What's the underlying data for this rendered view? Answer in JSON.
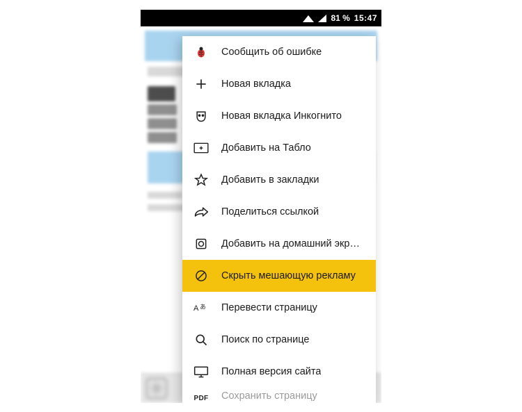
{
  "statusbar": {
    "battery": "81 %",
    "time": "15:47"
  },
  "menu": {
    "items": [
      {
        "label": "Сообщить об ошибке",
        "icon": "bug-icon",
        "highlight": false
      },
      {
        "label": "Новая вкладка",
        "icon": "plus-icon",
        "highlight": false
      },
      {
        "label": "Новая вкладка Инкогнито",
        "icon": "incognito-icon",
        "highlight": false
      },
      {
        "label": "Добавить на Табло",
        "icon": "dashboard-icon",
        "highlight": false
      },
      {
        "label": "Добавить в закладки",
        "icon": "star-icon",
        "highlight": false
      },
      {
        "label": "Поделиться ссылкой",
        "icon": "share-icon",
        "highlight": false
      },
      {
        "label": "Добавить на домашний экр…",
        "icon": "homescreen-icon",
        "highlight": false
      },
      {
        "label": "Скрыть мешающую рекламу",
        "icon": "block-icon",
        "highlight": true
      },
      {
        "label": "Перевести страницу",
        "icon": "translate-icon",
        "highlight": false
      },
      {
        "label": "Поиск по странице",
        "icon": "search-icon",
        "highlight": false
      },
      {
        "label": "Полная версия сайта",
        "icon": "desktop-icon",
        "highlight": false
      },
      {
        "label": "Сохранить страницу",
        "icon": "pdf-icon",
        "highlight": false,
        "cut": true
      }
    ]
  },
  "pdf_label": "PDF"
}
